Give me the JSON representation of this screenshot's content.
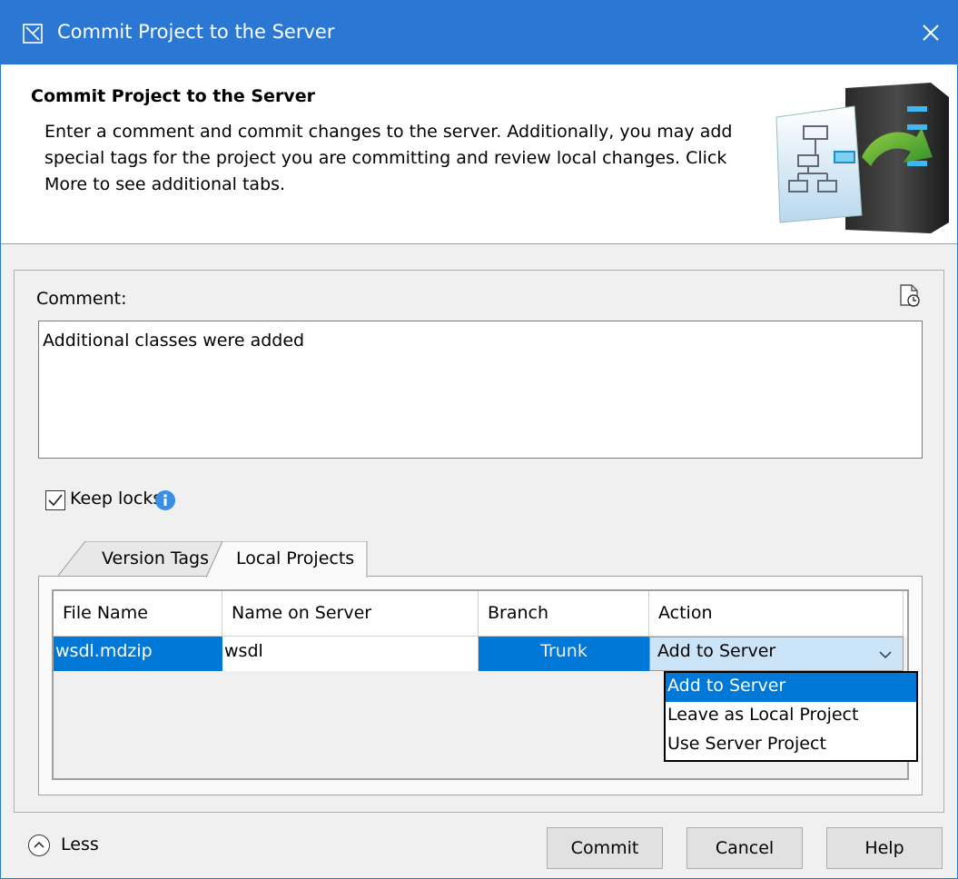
{
  "window": {
    "title": "Commit Project to the Server",
    "close_icon": "close-icon",
    "app_icon": "dialog-icon"
  },
  "header": {
    "title": "Commit Project to the Server",
    "description": "Enter a comment and commit changes to the server. Additionally, you may add special tags for the project you are committing and review local changes. Click More to see additional tabs.",
    "illustration": "server-commit-illustration"
  },
  "comment": {
    "label": "Comment:",
    "value": "Additional classes were added",
    "history_icon": "comment-history-icon"
  },
  "keep_locks": {
    "label": "Keep locks",
    "checked": true,
    "info_icon": "info-icon"
  },
  "tabs": [
    {
      "label": "Version Tags",
      "active": false
    },
    {
      "label": "Local Projects",
      "active": true
    }
  ],
  "table": {
    "columns": [
      "File Name",
      "Name on Server",
      "Branch",
      "Action"
    ],
    "rows": [
      {
        "file_name": "wsdl.mdzip",
        "name_on_server": "wsdl",
        "branch": "Trunk",
        "action": "Add to Server"
      }
    ]
  },
  "action_dropdown": {
    "selected": "Add to Server",
    "options": [
      "Add to Server",
      "Leave as Local Project",
      "Use Server Project"
    ]
  },
  "footer": {
    "less_label": "Less",
    "commit_label": "Commit",
    "cancel_label": "Cancel",
    "help_label": "Help"
  },
  "colors": {
    "accent": "#2b78d4",
    "selection": "#0078d7"
  }
}
